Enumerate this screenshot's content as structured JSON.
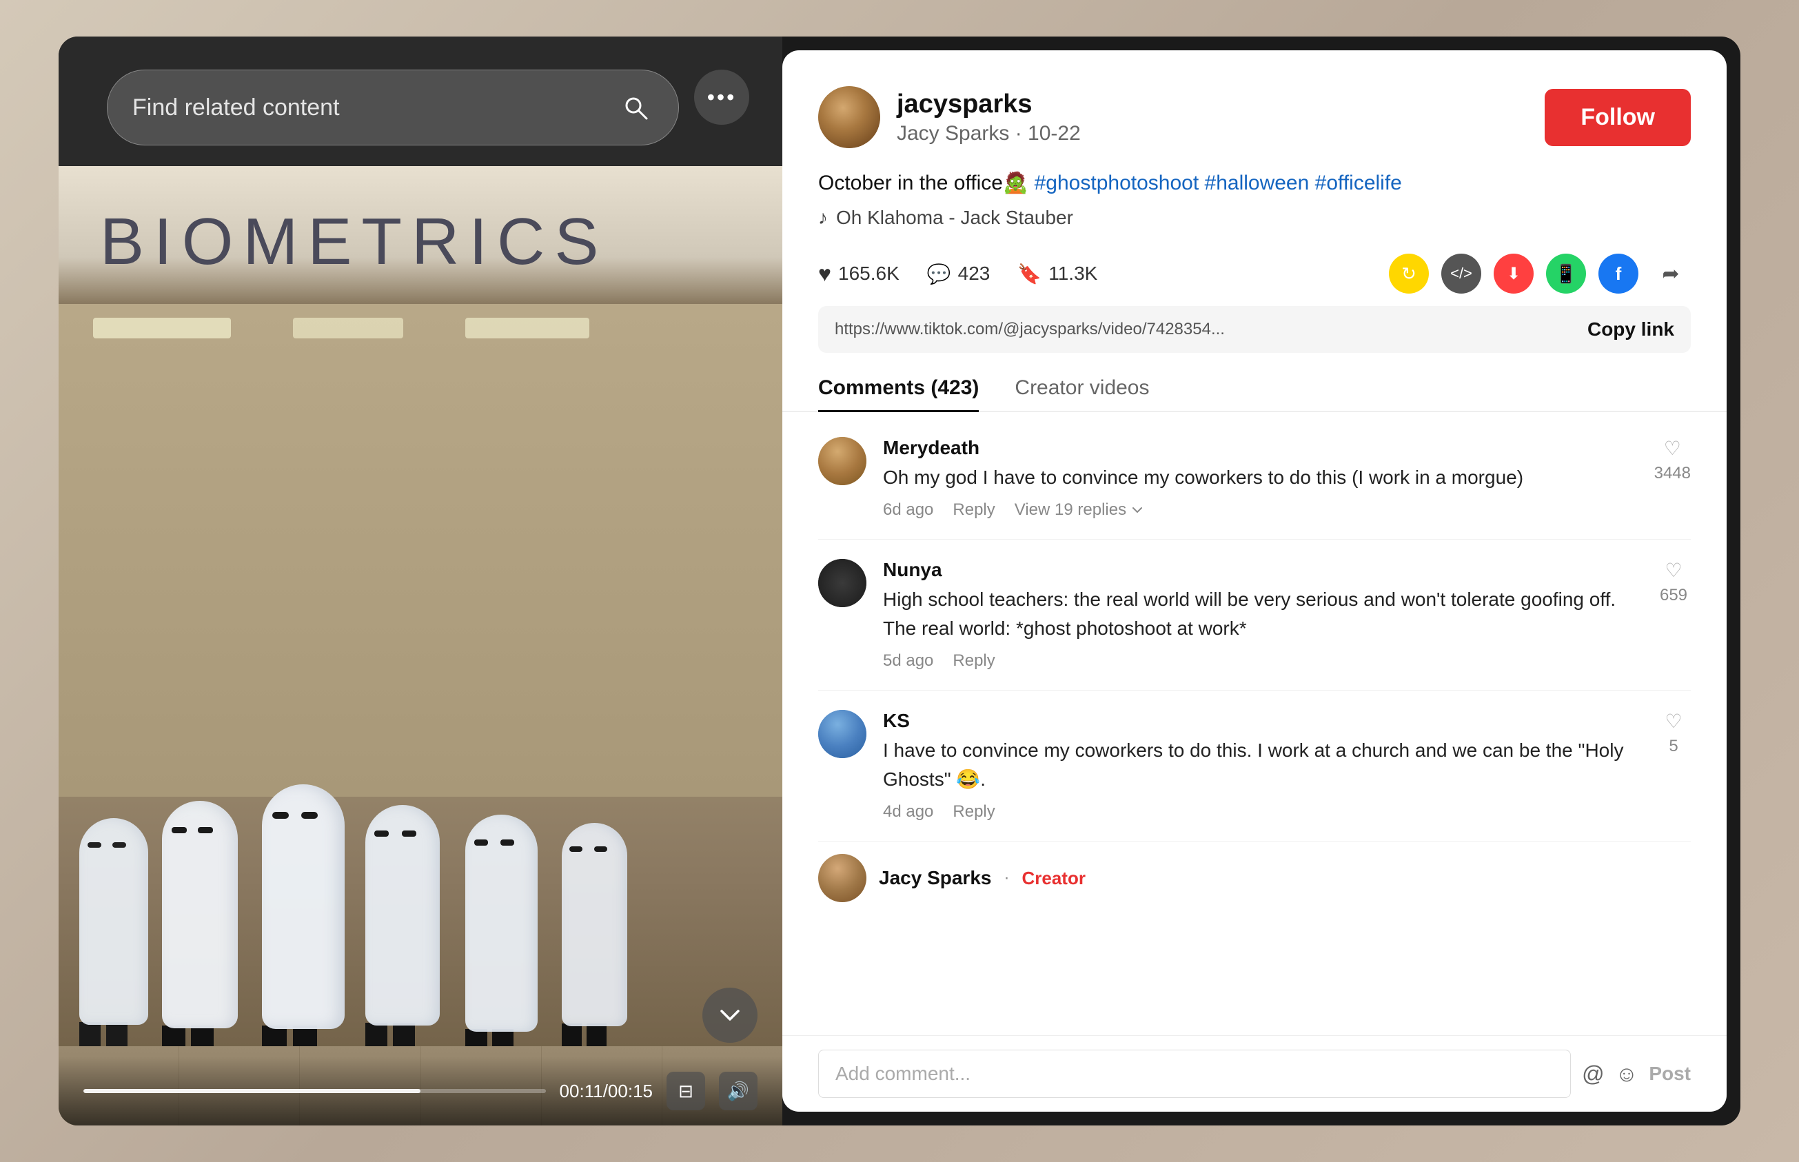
{
  "search": {
    "placeholder": "Find related content"
  },
  "video": {
    "title": "BIOMETRICS",
    "time_current": "00:11",
    "time_total": "00:15",
    "progress_percent": 73,
    "more_options_label": "•••"
  },
  "profile": {
    "username": "jacysparks",
    "handle": "Jacy Sparks · 10-22",
    "follow_label": "Follow",
    "caption": "October in the office🧟 #ghostphotoshoot #halloween #officelife",
    "music": "Oh Klahoma - Jack Stauber",
    "likes": "165.6K",
    "comments": "423",
    "bookmarks": "11.3K",
    "link_url": "https://www.tiktok.com/@jacysparks/video/7428354...",
    "copy_link_label": "Copy link"
  },
  "tabs": [
    {
      "label": "Comments (423)",
      "active": true
    },
    {
      "label": "Creator videos",
      "active": false
    }
  ],
  "comments": [
    {
      "username": "Merydeath",
      "text": "Oh my god I have to convince my coworkers to do this (I work in a morgue)",
      "time": "6d ago",
      "likes": "3448",
      "replies_count": "19",
      "is_creator": false
    },
    {
      "username": "Nunya",
      "text": "High school teachers: the real world will be very serious and won't tolerate goofing off. The real world: *ghost photoshoot at work*",
      "time": "5d ago",
      "likes": "659",
      "replies_count": null,
      "is_creator": false
    },
    {
      "username": "KS",
      "text": "I have to convince my coworkers to do this. I work at a church and we can be the \"Holy Ghosts\" 😂.",
      "time": "4d ago",
      "likes": "5",
      "replies_count": null,
      "is_creator": false
    },
    {
      "username": "Jacy Sparks",
      "text": "",
      "time": "",
      "likes": "",
      "replies_count": null,
      "is_creator": true
    }
  ],
  "comment_input": {
    "placeholder": "Add comment..."
  },
  "labels": {
    "reply": "Reply",
    "view_replies_prefix": "View",
    "view_replies_suffix": "replies",
    "post": "Post",
    "creator": "Creator"
  },
  "icons": {
    "search": "⌕",
    "music_note": "♪",
    "heart": "♡",
    "comment_bubble": "💬",
    "bookmark": "🔖",
    "repost": "↻",
    "more_dots": "•••",
    "chevron_down": "⌄",
    "volume": "🔊",
    "captions": "⊞",
    "share_arrow": "➦",
    "at": "@",
    "emoji": "☺",
    "whatsapp_color": "#25D366",
    "facebook_color": "#1877F2",
    "tiktok_repost_color": "#ffcc00",
    "embed_color": "#444",
    "download_color": "#ff4040"
  }
}
